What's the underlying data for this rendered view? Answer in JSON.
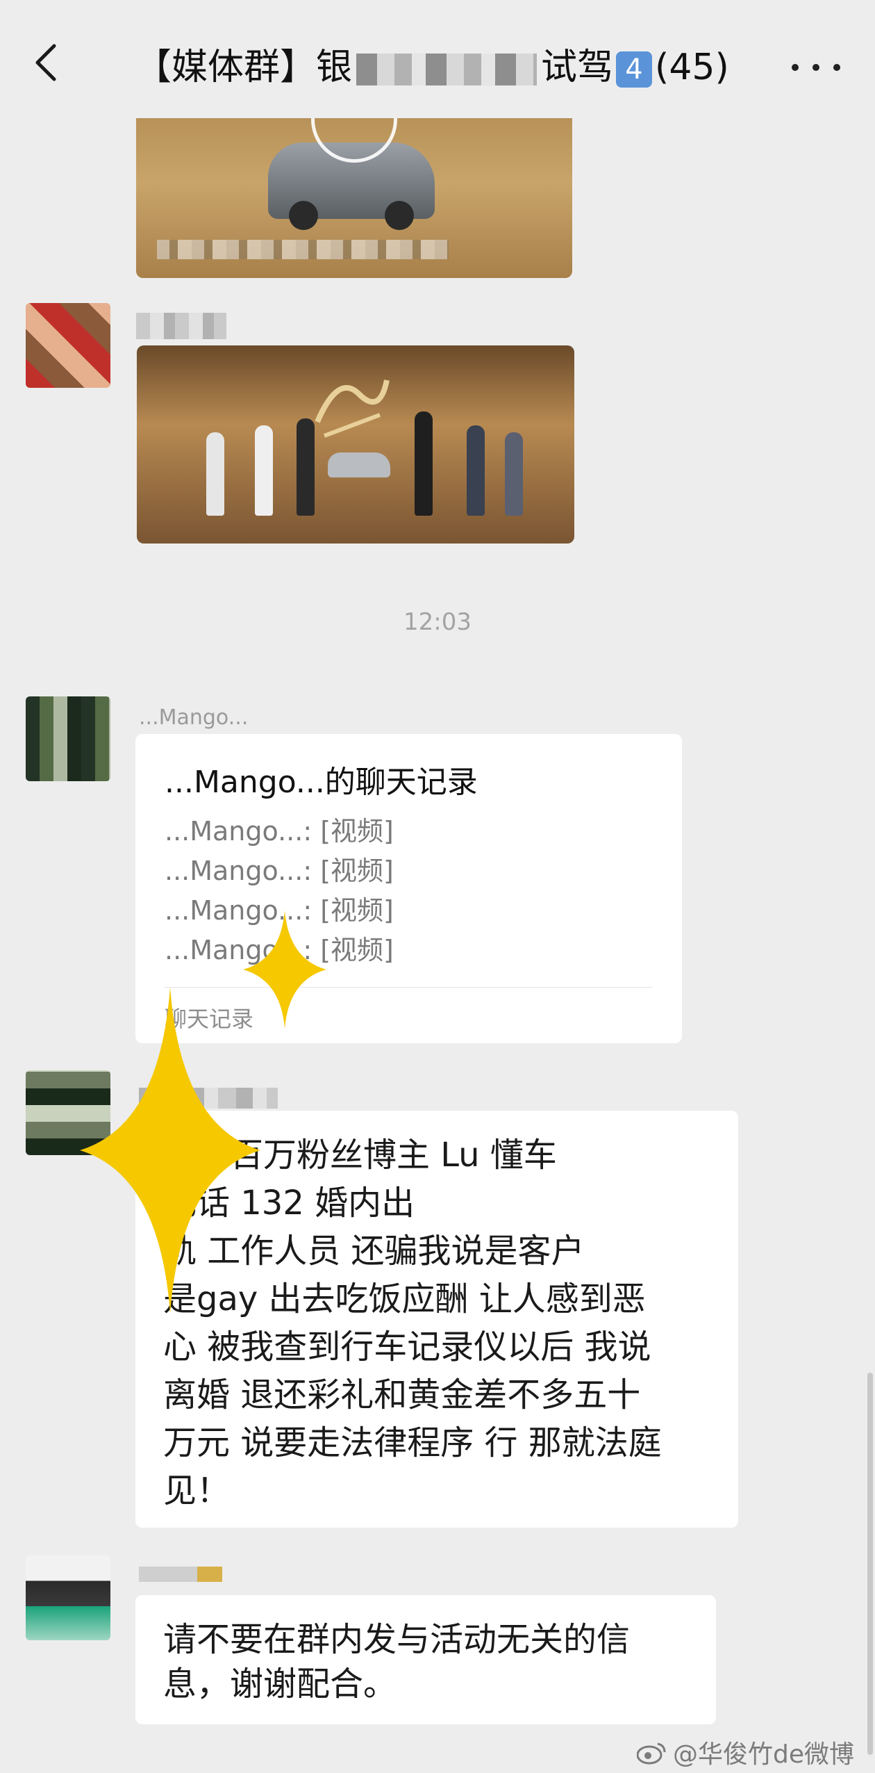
{
  "header": {
    "title_prefix": "【媒体群】银",
    "title_suffix": "试驾",
    "title_badge": "4",
    "member_count": "(45)"
  },
  "messages": {
    "timestamp": "12:03",
    "record_card": {
      "sender": "...Mango...",
      "title": "...Mango...的聊天记录",
      "lines": [
        "...Mango...: [视频]",
        "...Mango...: [视频]",
        "...Mango...: [视频]",
        "...Mango...: [视频]"
      ],
      "footer": "聊天记录"
    },
    "long_message": {
      "text": "抖音百万粉丝博主 Lu 懂车\n电话 132 婚内出\n轨 工作人员 还骗我说是客户\n是gay 出去吃饭应酬 让人感到恶\n心 被我查到行车记录仪以后 我说\n离婚 退还彩礼和黄金差不多五十\n万元 说要走法律程序 行 那就法庭\n见！"
    },
    "notice": {
      "text": "请不要在群内发与活动无关的信\n息，谢谢配合。"
    }
  },
  "watermark": "@华俊竹de微博",
  "icons": {
    "back": "chevron-left-icon",
    "more": "more-dots-icon"
  },
  "colors": {
    "background": "#ededed",
    "bubble": "#ffffff",
    "sparkle": "#f5c800"
  }
}
